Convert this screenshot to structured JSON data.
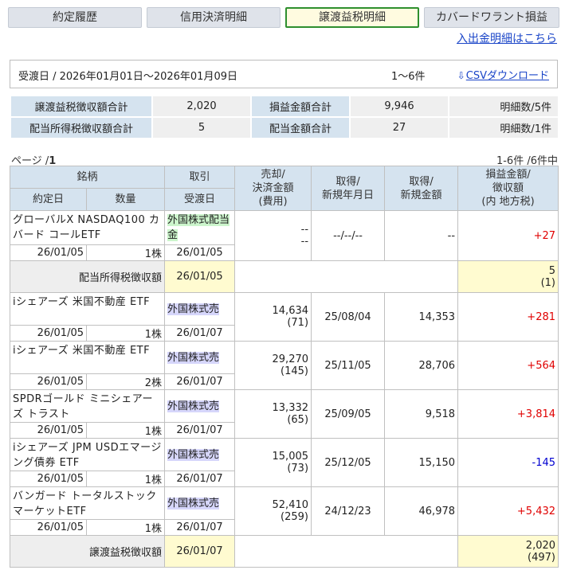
{
  "tabs": [
    {
      "label": "約定履歴",
      "active": false
    },
    {
      "label": "信用決済明細",
      "active": false
    },
    {
      "label": "譲渡益税明細",
      "active": true
    },
    {
      "label": "カバードワラント損益",
      "active": false
    }
  ],
  "top_link": "入出金明細はこちら",
  "date_range": "受渡日 / 2026年01月01日～2026年01月09日",
  "count": "1～6件",
  "csv_label": "CSVダウンロード",
  "summary": {
    "row1": {
      "label1": "譲渡益税徴収額合計",
      "value1": "2,020",
      "label2": "損益金額合計",
      "value2": "9,946",
      "count": "明細数/5件"
    },
    "row2": {
      "label1": "配当所得税徴収額合計",
      "value1": "5",
      "label2": "配当金額合計",
      "value2": "27",
      "count": "明細数/1件"
    }
  },
  "page": {
    "label": "ページ /",
    "number": "1",
    "range": "1-6件 /6件中"
  },
  "headers": {
    "meigara": "銘柄",
    "torihiki": "取引",
    "baikyaku_1": "売却/",
    "baikyaku_2": "決済金額",
    "baikyaku_3": "(費用)",
    "shutoku_date_1": "取得/",
    "shutoku_date_2": "新規年月日",
    "shutoku_amt_1": "取得/",
    "shutoku_amt_2": "新規金額",
    "pl_1": "損益金額/",
    "pl_2": "徴収額",
    "pl_3": "(内 地方税)",
    "yakujo": "約定日",
    "suryo": "数量",
    "ukewatashi": "受渡日"
  },
  "dividend": {
    "name": "グローバルX NASDAQ100 カバード コールETF",
    "type": "外国株式配当金",
    "sell": "--",
    "fee": "--",
    "acq_date": "--/--/--",
    "acq_amt": "--",
    "pl": "+27",
    "trade_date": "26/01/05",
    "qty": "1株",
    "settle_date": "26/01/05",
    "tax_label": "配当所得税徴収額",
    "tax_date": "26/01/05",
    "tax_amt": "5",
    "tax_local": "(1)"
  },
  "rows": [
    {
      "name": "iシェアーズ 米国不動産 ETF",
      "type": "外国株式売",
      "sell": "14,634",
      "fee": "(71)",
      "acq_date": "25/08/04",
      "acq_amt": "14,353",
      "pl": "+281",
      "pl_sign": "plus",
      "trade_date": "26/01/05",
      "qty": "1株",
      "settle_date": "26/01/07"
    },
    {
      "name": "iシェアーズ 米国不動産 ETF",
      "type": "外国株式売",
      "sell": "29,270",
      "fee": "(145)",
      "acq_date": "25/11/05",
      "acq_amt": "28,706",
      "pl": "+564",
      "pl_sign": "plus",
      "trade_date": "26/01/05",
      "qty": "2株",
      "settle_date": "26/01/07"
    },
    {
      "name": "SPDRゴールド ミニシェアーズ トラスト",
      "type": "外国株式売",
      "sell": "13,332",
      "fee": "(65)",
      "acq_date": "25/09/05",
      "acq_amt": "9,518",
      "pl": "+3,814",
      "pl_sign": "plus",
      "trade_date": "26/01/05",
      "qty": "1株",
      "settle_date": "26/01/07"
    },
    {
      "name": "iシェアーズ JPM USDエマージング債券 ETF",
      "type": "外国株式売",
      "sell": "15,005",
      "fee": "(73)",
      "acq_date": "25/12/05",
      "acq_amt": "15,150",
      "pl": "-145",
      "pl_sign": "minus",
      "trade_date": "26/01/05",
      "qty": "1株",
      "settle_date": "26/01/07"
    },
    {
      "name": "バンガード トータルストックマーケットETF",
      "type": "外国株式売",
      "sell": "52,410",
      "fee": "(259)",
      "acq_date": "24/12/23",
      "acq_amt": "46,978",
      "pl": "+5,432",
      "pl_sign": "plus",
      "trade_date": "26/01/05",
      "qty": "1株",
      "settle_date": "26/01/07"
    }
  ],
  "transfer_tax": {
    "label": "譲渡益税徴収額",
    "date": "26/01/07",
    "amount": "2,020",
    "local": "(497)"
  },
  "colors": {
    "plus": "#e00000",
    "minus": "#0000d0",
    "header_bg": "#d5e3ef",
    "active_tab_border": "#2e8f2e",
    "link": "#1a45c8"
  },
  "icons": {
    "download": "download-arrow-icon"
  }
}
